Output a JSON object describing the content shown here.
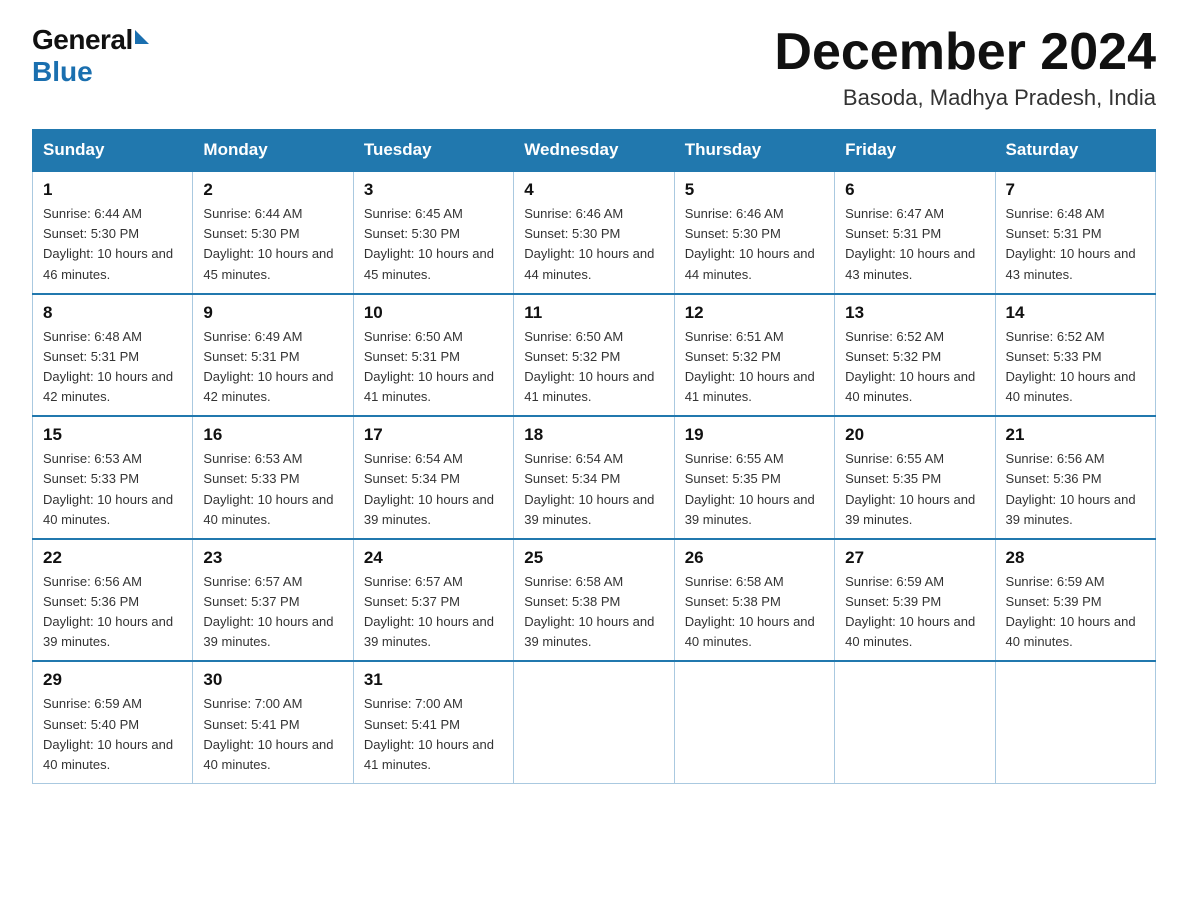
{
  "logo": {
    "general": "General",
    "triangle": "▶",
    "blue": "Blue"
  },
  "title": "December 2024",
  "location": "Basoda, Madhya Pradesh, India",
  "weekdays": [
    "Sunday",
    "Monday",
    "Tuesday",
    "Wednesday",
    "Thursday",
    "Friday",
    "Saturday"
  ],
  "weeks": [
    [
      {
        "day": "1",
        "sunrise": "6:44 AM",
        "sunset": "5:30 PM",
        "daylight": "10 hours and 46 minutes."
      },
      {
        "day": "2",
        "sunrise": "6:44 AM",
        "sunset": "5:30 PM",
        "daylight": "10 hours and 45 minutes."
      },
      {
        "day": "3",
        "sunrise": "6:45 AM",
        "sunset": "5:30 PM",
        "daylight": "10 hours and 45 minutes."
      },
      {
        "day": "4",
        "sunrise": "6:46 AM",
        "sunset": "5:30 PM",
        "daylight": "10 hours and 44 minutes."
      },
      {
        "day": "5",
        "sunrise": "6:46 AM",
        "sunset": "5:30 PM",
        "daylight": "10 hours and 44 minutes."
      },
      {
        "day": "6",
        "sunrise": "6:47 AM",
        "sunset": "5:31 PM",
        "daylight": "10 hours and 43 minutes."
      },
      {
        "day": "7",
        "sunrise": "6:48 AM",
        "sunset": "5:31 PM",
        "daylight": "10 hours and 43 minutes."
      }
    ],
    [
      {
        "day": "8",
        "sunrise": "6:48 AM",
        "sunset": "5:31 PM",
        "daylight": "10 hours and 42 minutes."
      },
      {
        "day": "9",
        "sunrise": "6:49 AM",
        "sunset": "5:31 PM",
        "daylight": "10 hours and 42 minutes."
      },
      {
        "day": "10",
        "sunrise": "6:50 AM",
        "sunset": "5:31 PM",
        "daylight": "10 hours and 41 minutes."
      },
      {
        "day": "11",
        "sunrise": "6:50 AM",
        "sunset": "5:32 PM",
        "daylight": "10 hours and 41 minutes."
      },
      {
        "day": "12",
        "sunrise": "6:51 AM",
        "sunset": "5:32 PM",
        "daylight": "10 hours and 41 minutes."
      },
      {
        "day": "13",
        "sunrise": "6:52 AM",
        "sunset": "5:32 PM",
        "daylight": "10 hours and 40 minutes."
      },
      {
        "day": "14",
        "sunrise": "6:52 AM",
        "sunset": "5:33 PM",
        "daylight": "10 hours and 40 minutes."
      }
    ],
    [
      {
        "day": "15",
        "sunrise": "6:53 AM",
        "sunset": "5:33 PM",
        "daylight": "10 hours and 40 minutes."
      },
      {
        "day": "16",
        "sunrise": "6:53 AM",
        "sunset": "5:33 PM",
        "daylight": "10 hours and 40 minutes."
      },
      {
        "day": "17",
        "sunrise": "6:54 AM",
        "sunset": "5:34 PM",
        "daylight": "10 hours and 39 minutes."
      },
      {
        "day": "18",
        "sunrise": "6:54 AM",
        "sunset": "5:34 PM",
        "daylight": "10 hours and 39 minutes."
      },
      {
        "day": "19",
        "sunrise": "6:55 AM",
        "sunset": "5:35 PM",
        "daylight": "10 hours and 39 minutes."
      },
      {
        "day": "20",
        "sunrise": "6:55 AM",
        "sunset": "5:35 PM",
        "daylight": "10 hours and 39 minutes."
      },
      {
        "day": "21",
        "sunrise": "6:56 AM",
        "sunset": "5:36 PM",
        "daylight": "10 hours and 39 minutes."
      }
    ],
    [
      {
        "day": "22",
        "sunrise": "6:56 AM",
        "sunset": "5:36 PM",
        "daylight": "10 hours and 39 minutes."
      },
      {
        "day": "23",
        "sunrise": "6:57 AM",
        "sunset": "5:37 PM",
        "daylight": "10 hours and 39 minutes."
      },
      {
        "day": "24",
        "sunrise": "6:57 AM",
        "sunset": "5:37 PM",
        "daylight": "10 hours and 39 minutes."
      },
      {
        "day": "25",
        "sunrise": "6:58 AM",
        "sunset": "5:38 PM",
        "daylight": "10 hours and 39 minutes."
      },
      {
        "day": "26",
        "sunrise": "6:58 AM",
        "sunset": "5:38 PM",
        "daylight": "10 hours and 40 minutes."
      },
      {
        "day": "27",
        "sunrise": "6:59 AM",
        "sunset": "5:39 PM",
        "daylight": "10 hours and 40 minutes."
      },
      {
        "day": "28",
        "sunrise": "6:59 AM",
        "sunset": "5:39 PM",
        "daylight": "10 hours and 40 minutes."
      }
    ],
    [
      {
        "day": "29",
        "sunrise": "6:59 AM",
        "sunset": "5:40 PM",
        "daylight": "10 hours and 40 minutes."
      },
      {
        "day": "30",
        "sunrise": "7:00 AM",
        "sunset": "5:41 PM",
        "daylight": "10 hours and 40 minutes."
      },
      {
        "day": "31",
        "sunrise": "7:00 AM",
        "sunset": "5:41 PM",
        "daylight": "10 hours and 41 minutes."
      },
      null,
      null,
      null,
      null
    ]
  ]
}
